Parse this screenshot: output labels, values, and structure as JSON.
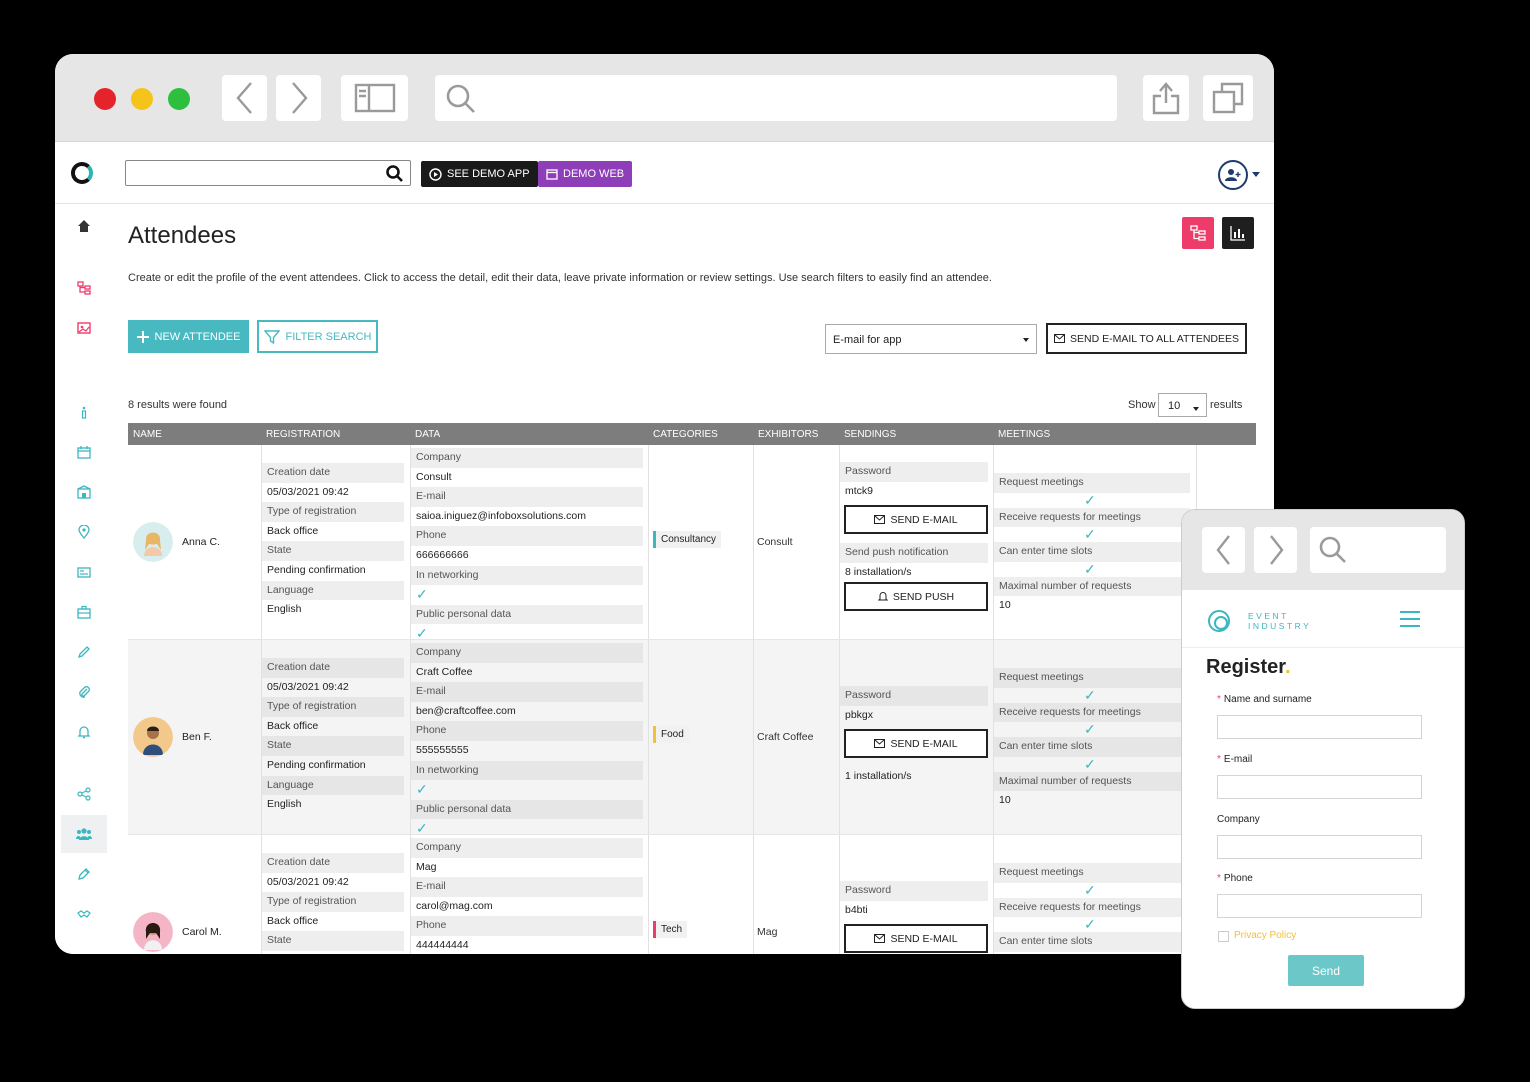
{
  "app": {
    "demo_app_label": "SEE DEMO APP",
    "demo_web_label": "DEMO WEB"
  },
  "page": {
    "title": "Attendees",
    "description": "Create or edit the profile of the event attendees. Click to access the detail, edit their data, leave private information or review settings. Use search filters to easily find an attendee."
  },
  "actions": {
    "new_attendee": "NEW ATTENDEE",
    "filter_search": "FILTER SEARCH",
    "email_select": "E-mail for app",
    "send_all": "SEND E-MAIL TO ALL ATTENDEES"
  },
  "results": {
    "found": "8 results were found",
    "show_label": "Show",
    "show_value": "10",
    "show_suffix": "results"
  },
  "table": {
    "columns": [
      "NAME",
      "REGISTRATION",
      "DATA",
      "CATEGORIES",
      "EXHIBITORS",
      "SENDINGS",
      "MEETINGS"
    ],
    "labels": {
      "creation_date": "Creation date",
      "type_of_registration": "Type of registration",
      "state": "State",
      "language": "Language",
      "company": "Company",
      "email": "E-mail",
      "phone": "Phone",
      "in_networking": "In networking",
      "public_personal_data": "Public personal data",
      "password": "Password",
      "send_email": "SEND E-MAIL",
      "send_push_notification": "Send push notification",
      "send_push": "SEND PUSH",
      "request_meetings": "Request meetings",
      "receive_requests": "Receive requests for meetings",
      "time_slots": "Can enter time slots",
      "max_requests": "Maximal number of requests"
    },
    "rows": [
      {
        "name": "Anna C.",
        "creation_date": "05/03/2021 09:42",
        "registration_type": "Back office",
        "state": "Pending confirmation",
        "language": "English",
        "company": "Consult",
        "email": "saioa.iniguez@infoboxsolutions.com",
        "phone": "666666666",
        "category": "Consultancy",
        "exhibitor": "Consult",
        "password": "mtck9",
        "installations": "8 installation/s",
        "max_requests_value": "10"
      },
      {
        "name": "Ben F.",
        "creation_date": "05/03/2021 09:42",
        "registration_type": "Back office",
        "state": "Pending confirmation",
        "language": "English",
        "company": "Craft Coffee",
        "email": "ben@craftcoffee.com",
        "phone": "555555555",
        "category": "Food",
        "exhibitor": "Craft Coffee",
        "password": "pbkgx",
        "installations": "1 installation/s",
        "max_requests_value": "10"
      },
      {
        "name": "Carol M.",
        "creation_date": "05/03/2021 09:42",
        "registration_type": "Back office",
        "company": "Mag",
        "email": "carol@mag.com",
        "phone": "444444444",
        "category": "Tech",
        "exhibitor": "Mag",
        "password": "b4bti"
      }
    ]
  },
  "mobile": {
    "brand_line1": "EVENT",
    "brand_line2": "INDUSTRY",
    "title": "Register",
    "title_dot": ".",
    "fields": {
      "name": "Name and surname",
      "email": "E-mail",
      "company": "Company",
      "phone": "Phone"
    },
    "required_mark": "*",
    "privacy": "Privacy Policy",
    "send": "Send"
  },
  "colors": {
    "accent_teal": "#48b9c0",
    "accent_purple": "#8e3eb8",
    "accent_pink": "#ee3c6a",
    "accent_yellow": "#f0c13a"
  }
}
